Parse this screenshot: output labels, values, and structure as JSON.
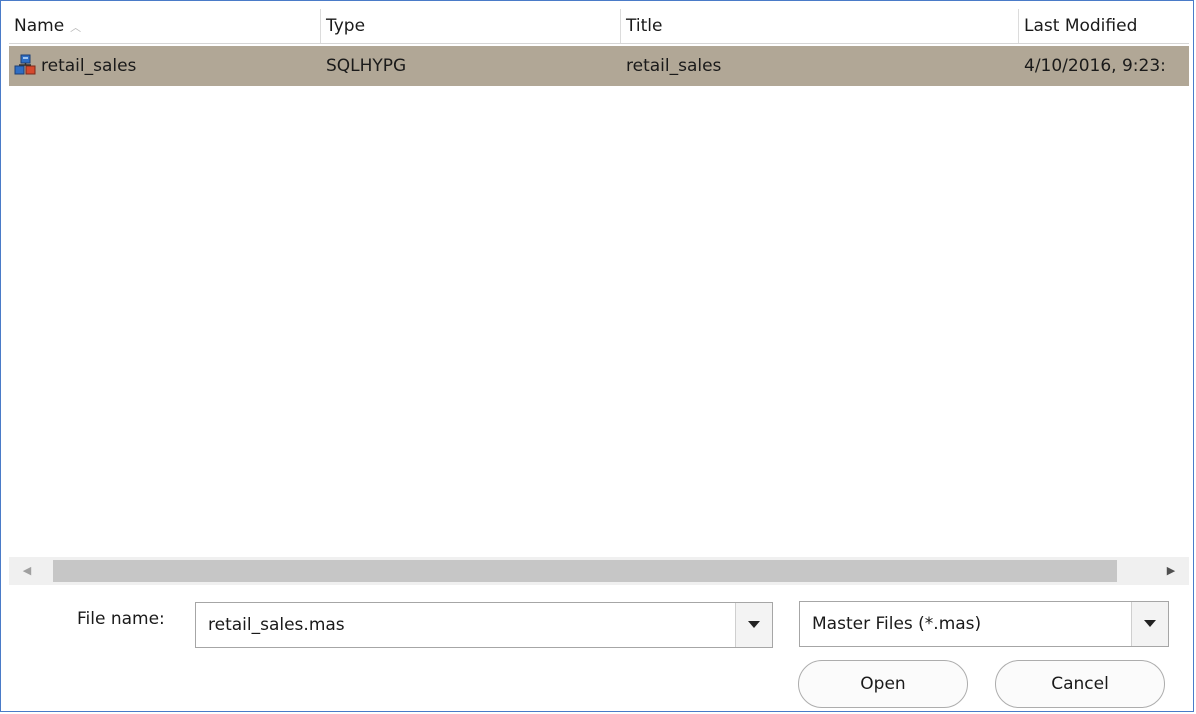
{
  "columns": {
    "name": "Name",
    "type": "Type",
    "title": "Title",
    "last_modified": "Last Modified"
  },
  "rows": [
    {
      "name": "retail_sales",
      "type": "SQLHYPG",
      "title": "retail_sales",
      "last_modified": "4/10/2016, 9:23:"
    }
  ],
  "file_name": {
    "label": "File name:",
    "value": "retail_sales.mas"
  },
  "file_type": {
    "value": "Master Files (*.mas)"
  },
  "buttons": {
    "open": "Open",
    "cancel": "Cancel"
  },
  "icons": {
    "file": "master-file-icon",
    "sort": "sort-ascending-icon",
    "dropdown": "chevron-down-icon",
    "scroll_left": "scroll-left-arrow-icon",
    "scroll_right": "scroll-right-arrow-icon"
  },
  "colors": {
    "selected_row": "#b1a796",
    "dialog_border": "#4a7bc8"
  }
}
